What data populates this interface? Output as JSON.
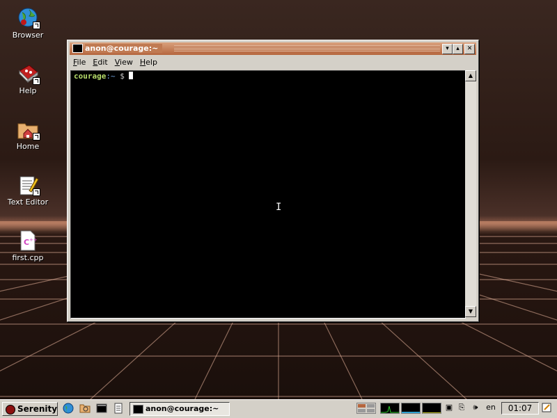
{
  "desktop": {
    "icons": [
      {
        "label": "Browser",
        "icon": "browser-globe-icon"
      },
      {
        "label": "Help",
        "icon": "help-book-icon"
      },
      {
        "label": "Home",
        "icon": "home-folder-icon"
      },
      {
        "label": "Text Editor",
        "icon": "text-editor-icon"
      },
      {
        "label": "first.cpp",
        "icon": "cpp-file-icon"
      }
    ]
  },
  "terminal": {
    "title": "anon@courage:~",
    "menu": [
      "File",
      "Edit",
      "View",
      "Help"
    ],
    "prompt_user": "courage",
    "prompt_path": ":~",
    "prompt_symbol": " $ "
  },
  "taskbar": {
    "start_label": "Serenity",
    "task_title": "anon@courage:~",
    "keyboard_layout": "en",
    "clock": "01:07"
  }
}
